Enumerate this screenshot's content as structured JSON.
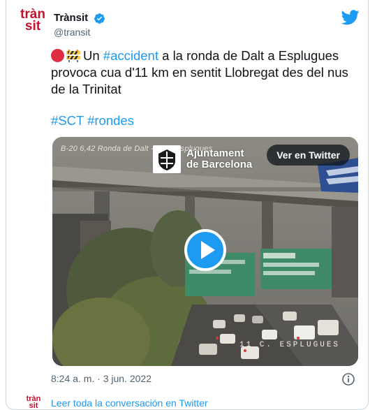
{
  "tweet": {
    "avatar": {
      "line1": "tràn",
      "line2": "sit"
    },
    "display_name": "Trànsit",
    "handle": "@transit",
    "verified_icon": "verified-badge-icon",
    "platform_icon": "twitter-bird-icon",
    "text": {
      "emoji1": "red-circle-emoji",
      "emoji2": "construction-barrier-emoji",
      "pre": "Un ",
      "hashtag": "#accident",
      "post": " a la ronda de Dalt a Esplugues provoca cua d'11 km en sentit Llobregat des del nus de la Trinitat"
    },
    "hashtags": [
      "#SCT",
      "#rondes"
    ],
    "media": {
      "camera_caption": "B-20 6,42 Ronda de Dalt - Ctra. Esplugues",
      "camera_footer": "11 C. ESPLUGUES",
      "brand_line1": "Ajuntament",
      "brand_line2": "de Barcelona",
      "watch_label": "Ver en Twitter",
      "play_icon": "play-icon"
    },
    "timestamp": "8:24 a. m. · 3 jun. 2022",
    "info_icon": "info-icon"
  },
  "footer": {
    "avatar": {
      "line1": "tràn",
      "line2": "sit"
    },
    "read_link": "Leer toda la conversación en Twitter"
  },
  "colors": {
    "link": "#1d9bf0",
    "brand": "#c8102e",
    "text": "#0f1419",
    "muted": "#536471"
  }
}
